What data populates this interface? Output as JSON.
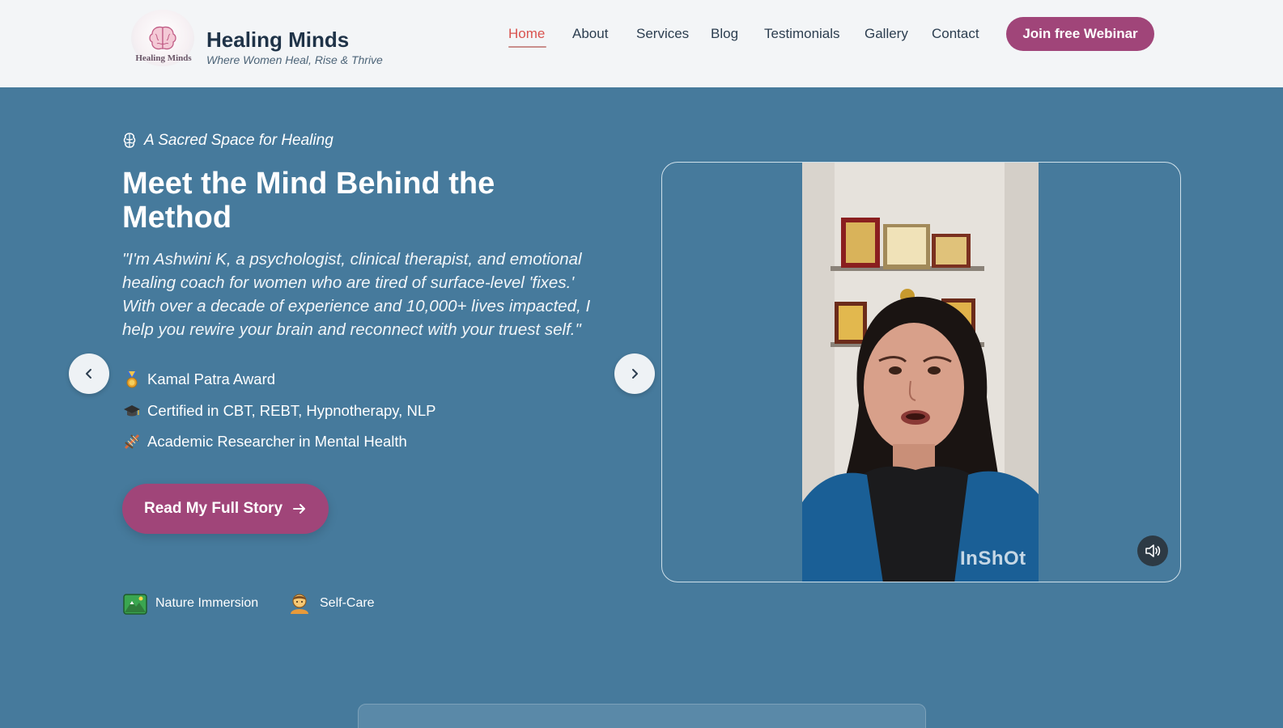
{
  "header": {
    "logo_text": "Healing Minds",
    "brand_name": "Healing Minds",
    "tagline": "Where Women Heal, Rise & Thrive",
    "nav": [
      {
        "label": "Home",
        "active": true
      },
      {
        "label": "About",
        "active": false
      },
      {
        "label": "Services",
        "active": false
      },
      {
        "label": "Blog",
        "active": false
      },
      {
        "label": "Testimonials",
        "active": false
      },
      {
        "label": "Gallery",
        "active": false
      },
      {
        "label": "Contact",
        "active": false
      }
    ],
    "cta_label": "Join free Webinar"
  },
  "hero": {
    "eyebrow": "A Sacred Space for Healing",
    "title": "Meet the Mind Behind the Method",
    "quote": "\"I'm Ashwini K, a psychologist, clinical therapist, and emotional healing coach for women who are tired of surface-level 'fixes.' With over a decade of experience and 10,000+ lives impacted, I help you rewire your brain and reconnect with your truest self.\"",
    "credentials": [
      {
        "icon": "medal-icon",
        "text": "Kamal Patra Award"
      },
      {
        "icon": "graduation-cap-icon",
        "text": "Certified in CBT, REBT, Hypnotherapy, NLP"
      },
      {
        "icon": "dna-icon",
        "text": "Academic Researcher in Mental Health"
      }
    ],
    "cta_label": "Read My Full Story",
    "tags": [
      {
        "icon": "mountain-icon",
        "text": "Nature Immersion"
      },
      {
        "icon": "person-icon",
        "text": "Self-Care"
      }
    ]
  },
  "video": {
    "watermark": "InShOt"
  },
  "colors": {
    "header_bg": "#f3f5f7",
    "hero_bg": "#467a9c",
    "accent": "#a04579",
    "nav_active": "#d9534f"
  }
}
